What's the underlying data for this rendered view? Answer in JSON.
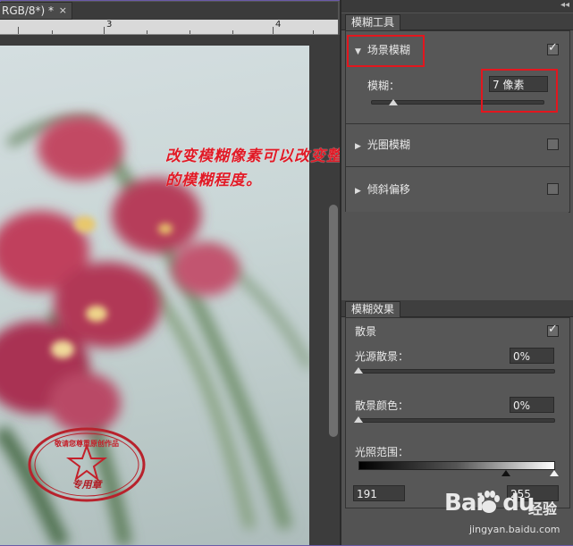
{
  "document": {
    "tab_title": "RGB/8*) *",
    "close_glyph": "×"
  },
  "ruler": {
    "marks": [
      "3",
      "4"
    ]
  },
  "annotation": {
    "line1": "改变模糊像素可以改变整个图片",
    "line2": "的模糊程度。"
  },
  "stamp": {
    "top_text": "敬请您尊重原创作品",
    "bottom_text": "专用章"
  },
  "blur_tools": {
    "panel_title": "模糊工具",
    "collapse_glyph": "◂◂",
    "field_blur": {
      "name": "场景模糊",
      "checked": true,
      "blur_label": "模糊：",
      "blur_value": "7 像素",
      "slider_level": 0.13
    },
    "iris_blur": {
      "name": "光圈模糊",
      "checked": false
    },
    "tilt_shift": {
      "name": "倾斜偏移",
      "checked": false
    }
  },
  "blur_effects": {
    "panel_title": "模糊效果",
    "bokeh_label": "散景",
    "bokeh_checked": true,
    "light_bokeh_label": "光源散景：",
    "light_bokeh_value": "0%",
    "light_bokeh_level": 0.0,
    "bokeh_color_label": "散景颜色：",
    "bokeh_color_value": "0%",
    "bokeh_color_level": 0.0,
    "light_range_label": "光照范围：",
    "light_range_min": "191",
    "light_range_max": "255"
  },
  "watermark": {
    "logo_bai": "Bai",
    "logo_du": "du",
    "cn_text": "经验",
    "url": "jingyan.baidu.com"
  },
  "colors": {
    "panel_bg": "#535353",
    "highlight_red": "#e3161e",
    "annotation_red": "#e01a26"
  }
}
